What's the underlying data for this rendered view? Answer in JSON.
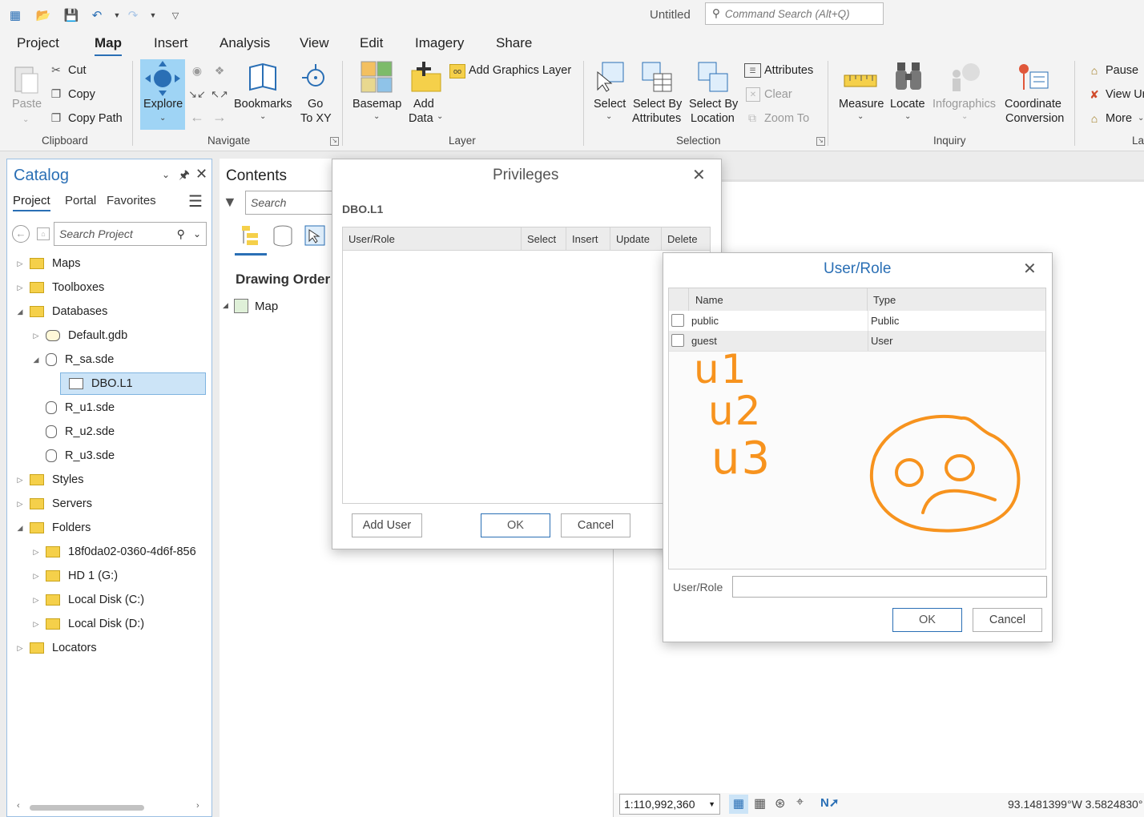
{
  "titlebar": {
    "doc_title": "Untitled",
    "search_placeholder": "Command Search (Alt+Q)"
  },
  "tabs": [
    "Project",
    "Map",
    "Insert",
    "Analysis",
    "View",
    "Edit",
    "Imagery",
    "Share"
  ],
  "active_tab": "Map",
  "ribbon": {
    "clipboard": {
      "label": "Clipboard",
      "paste": "Paste",
      "cut": "Cut",
      "copy": "Copy",
      "copy_path": "Copy Path"
    },
    "navigate": {
      "label": "Navigate",
      "explore": "Explore",
      "bookmarks": "Bookmarks",
      "go_to": "Go",
      "to_xy": "To XY"
    },
    "layer": {
      "label": "Layer",
      "basemap": "Basemap",
      "add": "Add",
      "data": "Data",
      "add_graphics_layer": "Add Graphics Layer"
    },
    "selection": {
      "label": "Selection",
      "select": "Select",
      "select_by": "Select By",
      "attributes": "Attributes",
      "location": "Location",
      "attributes_btn": "Attributes",
      "clear": "Clear",
      "zoom_to": "Zoom To"
    },
    "inquiry": {
      "label": "Inquiry",
      "measure": "Measure",
      "locate": "Locate",
      "infographics": "Infographics",
      "coordinate": "Coordinate",
      "conversion": "Conversion"
    },
    "labeling": {
      "label": "La",
      "pause": "Pause",
      "view_un": "View Ur",
      "more": "More"
    }
  },
  "catalog": {
    "title": "Catalog",
    "tabs": [
      "Project",
      "Portal",
      "Favorites"
    ],
    "search_placeholder": "Search Project",
    "tree": [
      {
        "label": "Maps",
        "expanded": false
      },
      {
        "label": "Toolboxes",
        "expanded": false
      },
      {
        "label": "Databases",
        "expanded": true
      },
      {
        "label": "Default.gdb",
        "expanded": false
      },
      {
        "label": "R_sa.sde",
        "expanded": true
      },
      {
        "label": "DBO.L1",
        "selected": true
      },
      {
        "label": "R_u1.sde"
      },
      {
        "label": "R_u2.sde"
      },
      {
        "label": "R_u3.sde"
      },
      {
        "label": "Styles",
        "expanded": false
      },
      {
        "label": "Servers",
        "expanded": false
      },
      {
        "label": "Folders",
        "expanded": true
      },
      {
        "label": "18f0da02-0360-4d6f-856",
        "expanded": false
      },
      {
        "label": "HD 1 (G:)",
        "expanded": false
      },
      {
        "label": "Local Disk (C:)",
        "expanded": false
      },
      {
        "label": "Local Disk (D:)",
        "expanded": false
      },
      {
        "label": "Locators",
        "expanded": false
      }
    ]
  },
  "contents": {
    "title": "Contents",
    "search_placeholder": "Search",
    "drawing_order": "Drawing Order",
    "map": "Map"
  },
  "privileges": {
    "title": "Privileges",
    "object": "DBO.L1",
    "columns": [
      "User/Role",
      "Select",
      "Insert",
      "Update",
      "Delete"
    ],
    "add_user": "Add User",
    "ok": "OK",
    "cancel": "Cancel"
  },
  "userrole": {
    "title": "User/Role",
    "columns": [
      "Name",
      "Type"
    ],
    "rows": [
      {
        "name": "public",
        "type": "Public"
      },
      {
        "name": "guest",
        "type": "User"
      }
    ],
    "handwritten": [
      "u1",
      "u2",
      "u3"
    ],
    "field_label": "User/Role",
    "field_value": "",
    "ok": "OK",
    "cancel": "Cancel",
    "annotation_color": "#f7931e"
  },
  "status": {
    "scale": "1:110,992,360",
    "coords": "93.1481399°W 3.5824830°"
  },
  "colors": {
    "accent": "#2a6fb5",
    "selection": "#cce4f7",
    "explore_bg": "#9fd4f5"
  }
}
